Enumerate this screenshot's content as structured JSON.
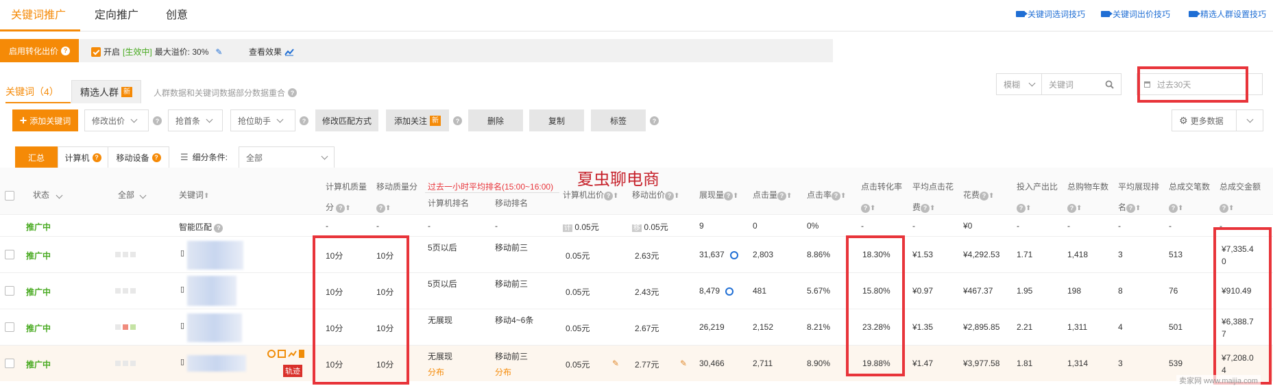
{
  "top_tabs": [
    "关键词推广",
    "定向推广",
    "创意"
  ],
  "top_tips": [
    "关键词选词技巧",
    "关键词出价技巧",
    "精选人群设置技巧"
  ],
  "bid_bar": {
    "button": "启用转化出价",
    "enabled": "开启",
    "status": "[生效中]",
    "max_premium": "最大溢价: 30%",
    "view_effect": "查看效果"
  },
  "sub_tabs": {
    "keywords": "关键词",
    "keywords_count": "（4）",
    "crowd": "精选人群",
    "new": "新",
    "notice": "人群数据和关键词数据部分数据重合"
  },
  "filter": {
    "mode": "模糊",
    "keyword_placeholder": "关键词",
    "date": "过去30天"
  },
  "toolbar": {
    "add_keyword": "添加关键词",
    "modify_bid": "修改出价",
    "grab_top": "抢首条",
    "position_helper": "抢位助手",
    "modify_match": "修改匹配方式",
    "add_follow": "添加关注",
    "new": "新",
    "delete": "删除",
    "copy": "复制",
    "tag": "标签",
    "more_data": "更多数据"
  },
  "segment": {
    "all_summary": "汇总",
    "computer": "计算机",
    "mobile": "移动设备",
    "sub_condition": "细分条件:",
    "sub_value": "全部"
  },
  "watermark": "夏虫聊电商",
  "header": {
    "status": "状态",
    "all": "全部",
    "keyword": "关键词",
    "pc_quality_1": "计算机质量",
    "pc_quality_2": "分",
    "mob_quality": "移动质量分",
    "avg_rank_title": "过去一小时平均排名(15:00~16:00)",
    "pc_rank": "计算机排名",
    "mob_rank": "移动排名",
    "pc_bid": "计算机出价",
    "mob_bid": "移动出价",
    "impressions": "展现量",
    "clicks": "点击量",
    "ctr": "点击率",
    "cvr": "点击转化率",
    "avg_cpc_1": "平均点击花",
    "avg_cpc_2": "费",
    "cost": "花费",
    "roi": "投入产出比",
    "carts": "总购物车数",
    "avg_rank_1": "平均展现排",
    "avg_rank_2": "名",
    "orders": "总成交笔数",
    "gmv": "总成交金额"
  },
  "smart_row": {
    "status": "推广中",
    "keyword": "智能匹配",
    "pc_q": "-",
    "mob_q": "-",
    "pc_rank": "-",
    "mob_rank": "-",
    "pc_tag": "计",
    "pc_bid": "0.05元",
    "mob_tag": "移",
    "mob_bid": "0.05元",
    "impr": "9",
    "clicks": "0",
    "ctr": "0%",
    "cvr": "-",
    "cpc": "-",
    "cost": "¥0",
    "roi": "-",
    "carts": "-",
    "rank": "-",
    "orders": "-",
    "gmv": "-"
  },
  "rows": [
    {
      "status": "推广中",
      "pc_q": "10分",
      "mob_q": "10分",
      "pc_rank": "5页以后",
      "mob_rank": "移动前三",
      "pc_bid": "0.05元",
      "mob_bid": "2.63元",
      "impr": "31,637",
      "clicks": "2,803",
      "ctr": "8.86%",
      "cvr": "18.30%",
      "cpc": "¥1.53",
      "cost": "¥4,292.53",
      "roi": "1.71",
      "carts": "1,418",
      "rank": "3",
      "orders": "513",
      "gmv1": "¥7,335.4",
      "gmv2": "0"
    },
    {
      "status": "推广中",
      "pc_q": "10分",
      "mob_q": "10分",
      "pc_rank": "5页以后",
      "mob_rank": "移动前三",
      "pc_bid": "0.05元",
      "mob_bid": "2.43元",
      "impr": "8,479",
      "clicks": "481",
      "ctr": "5.67%",
      "cvr": "15.80%",
      "cpc": "¥0.97",
      "cost": "¥467.37",
      "roi": "1.95",
      "carts": "198",
      "rank": "8",
      "orders": "76",
      "gmv1": "¥910.49",
      "gmv2": ""
    },
    {
      "status": "推广中",
      "pc_q": "10分",
      "mob_q": "10分",
      "pc_rank": "无展现",
      "mob_rank": "移动4~6条",
      "pc_bid": "0.05元",
      "mob_bid": "2.67元",
      "impr": "26,219",
      "clicks": "2,152",
      "ctr": "8.21%",
      "cvr": "23.28%",
      "cpc": "¥1.35",
      "cost": "¥2,895.85",
      "roi": "2.21",
      "carts": "1,311",
      "rank": "4",
      "orders": "501",
      "gmv1": "¥6,388.7",
      "gmv2": "7"
    },
    {
      "status": "推广中",
      "pc_q": "10分",
      "mob_q": "10分",
      "pc_rank": "无展现",
      "pc_rank_sub": "分布",
      "mob_rank": "移动前三",
      "mob_rank_sub": "分布",
      "pc_bid": "0.05元",
      "mob_bid": "2.77元",
      "impr": "30,466",
      "clicks": "2,711",
      "ctr": "8.90%",
      "cvr": "19.88%",
      "cpc": "¥1.47",
      "cost": "¥3,977.58",
      "roi": "1.81",
      "carts": "1,314",
      "rank": "3",
      "orders": "539",
      "gmv1": "¥7,208.0",
      "gmv2": "4",
      "tag": "轨迹"
    }
  ],
  "site_watermark": "卖家网 www.maijia.com"
}
